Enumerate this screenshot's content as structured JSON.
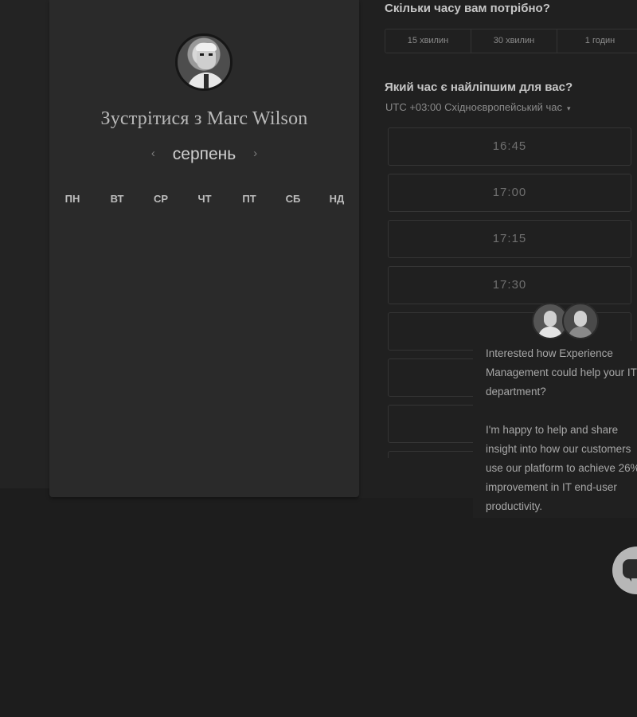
{
  "profile": {
    "title": "Зустрітися з Marc Wilson",
    "avatar_icon": "person-avatar-icon"
  },
  "calendar": {
    "month": "серпень",
    "prev_icon": "chevron-left-icon",
    "next_icon": "chevron-right-icon",
    "prev_glyph": "‹",
    "next_glyph": "›",
    "weekdays": [
      "ПН",
      "ВТ",
      "СР",
      "ЧТ",
      "ПТ",
      "СБ",
      "НД"
    ]
  },
  "duration": {
    "question": "Скільки часу вам потрібно?",
    "options": [
      "15 хвилин",
      "30 хвилин",
      "1 годин"
    ]
  },
  "time_picker": {
    "question": "Який час є найліпшим для вас?",
    "timezone": "UTC +03:00 Східноєвропейський час",
    "caret_glyph": "▾",
    "slots": [
      "16:45",
      "17:00",
      "17:15",
      "17:30",
      "",
      "",
      ""
    ]
  },
  "chat": {
    "message": "Interested how Experience Management could help your IT department?\n\nI'm happy to help and share insight into how our customers use our platform to achieve 26% improvement in IT end-user productivity.",
    "launcher_icon": "chat-bubble-icon"
  }
}
